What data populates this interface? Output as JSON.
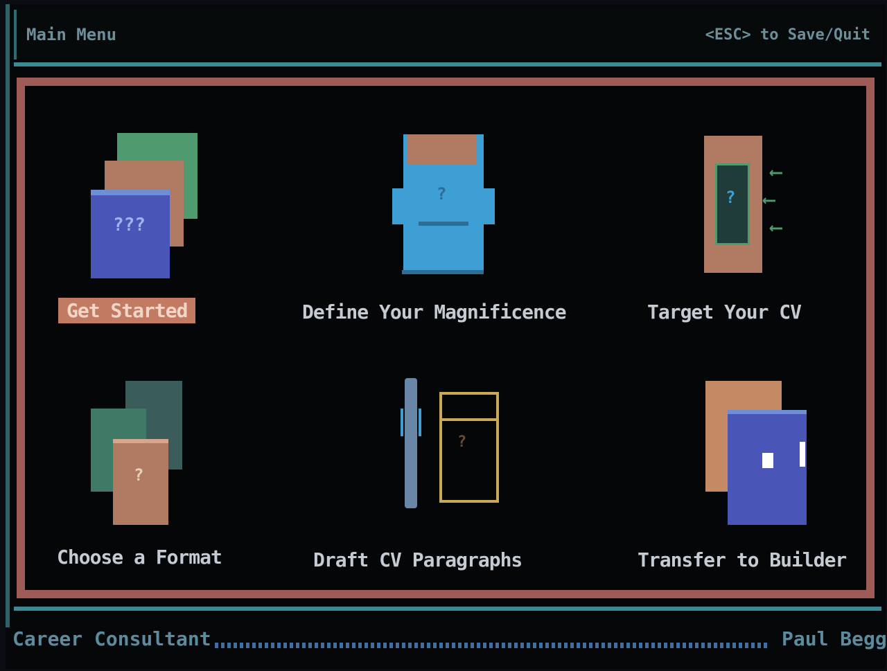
{
  "header": {
    "title": "Main Menu",
    "esc_hint": "<ESC> to Save/Quit"
  },
  "menu": {
    "items": [
      {
        "label": "Get Started",
        "selected": true
      },
      {
        "label": "Define Your Magnificence",
        "selected": false
      },
      {
        "label": "Target Your CV",
        "selected": false
      },
      {
        "label": "Choose a Format",
        "selected": false
      },
      {
        "label": "Draft CV Paragraphs",
        "selected": false
      },
      {
        "label": "Transfer to Builder",
        "selected": false
      }
    ]
  },
  "footer": {
    "app_name": "Career Consultant",
    "author": "Paul Begg"
  },
  "icons": {
    "get_started": {
      "name": "question-cards-icon",
      "glyph": "???"
    },
    "define": {
      "name": "blue-face-icon",
      "glyph": "?"
    },
    "target": {
      "name": "target-door-arrows-icon",
      "glyph": "?"
    },
    "format": {
      "name": "format-cards-icon",
      "glyph": "?"
    },
    "draft": {
      "name": "pen-and-page-icon",
      "glyph": "?"
    },
    "transfer": {
      "name": "transfer-cards-icon"
    }
  },
  "colors": {
    "frame": "#9e5b58",
    "teal_rule": "#3d8993",
    "selected_bg": "#c27b63",
    "label_text": "#c4cbd3"
  }
}
